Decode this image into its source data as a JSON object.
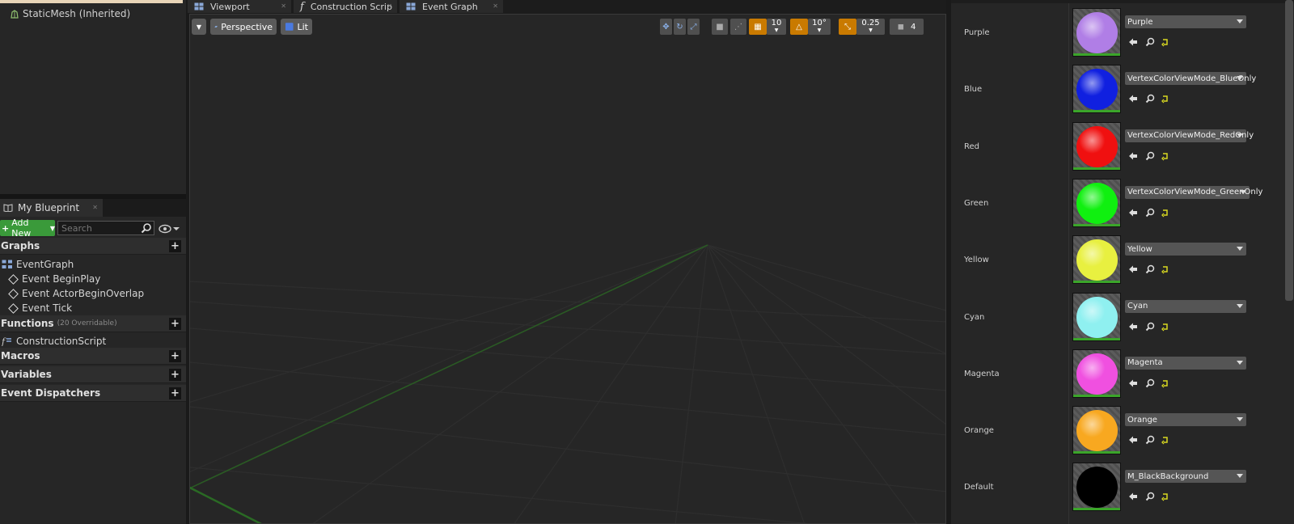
{
  "components": {
    "items": [
      {
        "label": "StaticMesh (Inherited)"
      }
    ]
  },
  "my_blueprint": {
    "tab_label": "My Blueprint",
    "add_new_label": "Add New",
    "search_placeholder": "Search",
    "sections": {
      "graphs": "Graphs",
      "functions": "Functions",
      "functions_sub": "(20 Overridable)",
      "macros": "Macros",
      "variables": "Variables",
      "dispatchers": "Event Dispatchers"
    },
    "graph_items": {
      "event_graph": "EventGraph",
      "events": [
        "Event BeginPlay",
        "Event ActorBeginOverlap",
        "Event Tick"
      ]
    },
    "function_items": [
      "ConstructionScript"
    ]
  },
  "editor_tabs": [
    {
      "label": "Viewport"
    },
    {
      "label": "Construction Scrip"
    },
    {
      "label": "Event Graph"
    }
  ],
  "viewport": {
    "view_mode_label": "Perspective",
    "lighting_label": "Lit",
    "grid_snap_value": "10",
    "rotation_snap_value": "10°",
    "scale_snap_value": "0.25",
    "camera_speed_value": "4",
    "snap_accent_color": "#c97a00"
  },
  "details": {
    "materials": [
      {
        "label": "Purple",
        "value": "Purple",
        "color": "#b07ee6"
      },
      {
        "label": "Blue",
        "value": "VertexColorViewMode_BlueOnly",
        "color": "#1020e0"
      },
      {
        "label": "Red",
        "value": "VertexColorViewMode_RedOnly",
        "color": "#f01010"
      },
      {
        "label": "Green",
        "value": "VertexColorViewMode_GreenOnly",
        "color": "#10f010"
      },
      {
        "label": "Yellow",
        "value": "Yellow",
        "color": "#e8f040"
      },
      {
        "label": "Cyan",
        "value": "Cyan",
        "color": "#8ff0f0"
      },
      {
        "label": "Magenta",
        "value": "Magenta",
        "color": "#f050e0"
      },
      {
        "label": "Orange",
        "value": "Orange",
        "color": "#f8a820"
      },
      {
        "label": "Default",
        "value": "M_BlackBackground",
        "color": "#000000"
      }
    ]
  }
}
